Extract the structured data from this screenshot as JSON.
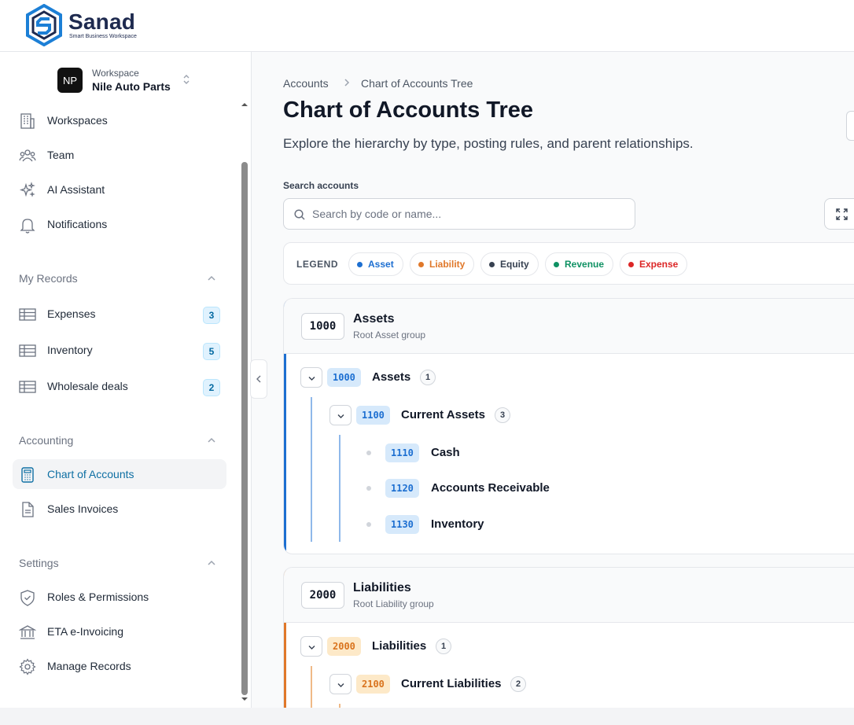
{
  "brand": {
    "name": "Sanad",
    "tagline": "Smart Business Workspace"
  },
  "workspace": {
    "initials": "NP",
    "label": "Workspace",
    "name": "Nile Auto Parts"
  },
  "nav_top": [
    {
      "label": "Workspaces",
      "icon": "building-icon"
    },
    {
      "label": "Team",
      "icon": "team-icon"
    },
    {
      "label": "AI Assistant",
      "icon": "sparkles-icon"
    },
    {
      "label": "Notifications",
      "icon": "bell-icon"
    }
  ],
  "my_records": {
    "title": "My Records",
    "items": [
      {
        "label": "Expenses",
        "count": "3",
        "icon": "table-icon"
      },
      {
        "label": "Inventory",
        "count": "5",
        "icon": "table-icon"
      },
      {
        "label": "Wholesale deals",
        "count": "2",
        "icon": "table-icon"
      }
    ]
  },
  "accounting": {
    "title": "Accounting",
    "items": [
      {
        "label": "Chart of Accounts",
        "icon": "calculator-icon",
        "active": true
      },
      {
        "label": "Sales Invoices",
        "icon": "document-icon",
        "active": false
      }
    ]
  },
  "settings": {
    "title": "Settings",
    "items": [
      {
        "label": "Roles & Permissions",
        "icon": "shield-icon"
      },
      {
        "label": "ETA e-Invoicing",
        "icon": "bank-icon"
      },
      {
        "label": "Manage Records",
        "icon": "gear-icon"
      }
    ]
  },
  "breadcrumb": {
    "root": "Accounts",
    "current": "Chart of Accounts Tree"
  },
  "page": {
    "title": "Chart of Accounts Tree",
    "subtitle": "Explore the hierarchy by type, posting rules, and parent relationships."
  },
  "search": {
    "label": "Search accounts",
    "placeholder": "Search by code or name...",
    "value": ""
  },
  "legend": {
    "title": "LEGEND",
    "items": [
      {
        "label": "Asset",
        "color": "#1d6fd1"
      },
      {
        "label": "Liability",
        "color": "#e0782a"
      },
      {
        "label": "Equity",
        "color": "#374151"
      },
      {
        "label": "Revenue",
        "color": "#0f9163"
      },
      {
        "label": "Expense",
        "color": "#dc2626"
      }
    ]
  },
  "groups": [
    {
      "code": "1000",
      "name": "Assets",
      "sub": "Root Asset group",
      "color": "#1d6fd1",
      "root": {
        "code": "1000",
        "name": "Assets",
        "count": "1"
      },
      "child": {
        "code": "1100",
        "name": "Current Assets",
        "count": "3"
      },
      "leaves": [
        {
          "code": "1110",
          "name": "Cash"
        },
        {
          "code": "1120",
          "name": "Accounts Receivable"
        },
        {
          "code": "1130",
          "name": "Inventory"
        }
      ]
    },
    {
      "code": "2000",
      "name": "Liabilities",
      "sub": "Root Liability group",
      "color": "#e0782a",
      "root": {
        "code": "2000",
        "name": "Liabilities",
        "count": "1"
      },
      "child": {
        "code": "2100",
        "name": "Current Liabilities",
        "count": "2"
      }
    }
  ]
}
